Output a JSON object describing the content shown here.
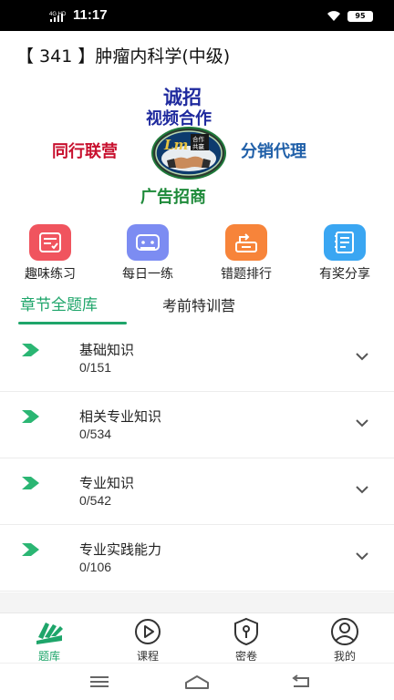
{
  "status_bar": {
    "network": "4G HD",
    "time": "11:17",
    "battery": "95"
  },
  "page": {
    "title": "【 341 】肿瘤内科学(中级)"
  },
  "banner": {
    "recruit": "诚招",
    "video_coop": "视频合作",
    "peer_alliance": "同行联营",
    "distribution_agent": "分销代理",
    "ad_investment": "广告招商",
    "logo_letters": "Lm",
    "logo_badge_top": "合作",
    "logo_badge_bottom": "共赢"
  },
  "shortcuts": [
    {
      "label": "趣味练习",
      "icon": "checklist-icon",
      "color": "#f0545e"
    },
    {
      "label": "每日一练",
      "icon": "game-controller-icon",
      "color": "#7c8cf2"
    },
    {
      "label": "错题排行",
      "icon": "error-ranking-icon",
      "color": "#f7843a"
    },
    {
      "label": "有奖分享",
      "icon": "notebook-icon",
      "color": "#3aa6f2"
    }
  ],
  "tabs": {
    "active": "章节全题库",
    "inactive": "考前特训营"
  },
  "chapters": [
    {
      "name": "基础知识",
      "progress": "0/151"
    },
    {
      "name": "相关专业知识",
      "progress": "0/534"
    },
    {
      "name": "专业知识",
      "progress": "0/542"
    },
    {
      "name": "专业实践能力",
      "progress": "0/106"
    }
  ],
  "bottom_nav": [
    {
      "label": "题库",
      "icon": "books-icon",
      "active": true
    },
    {
      "label": "课程",
      "icon": "play-icon",
      "active": false
    },
    {
      "label": "密卷",
      "icon": "shield-key-icon",
      "active": false
    },
    {
      "label": "我的",
      "icon": "user-icon",
      "active": false
    }
  ],
  "colors": {
    "accent": "#1ea56a",
    "text": "#222222"
  }
}
